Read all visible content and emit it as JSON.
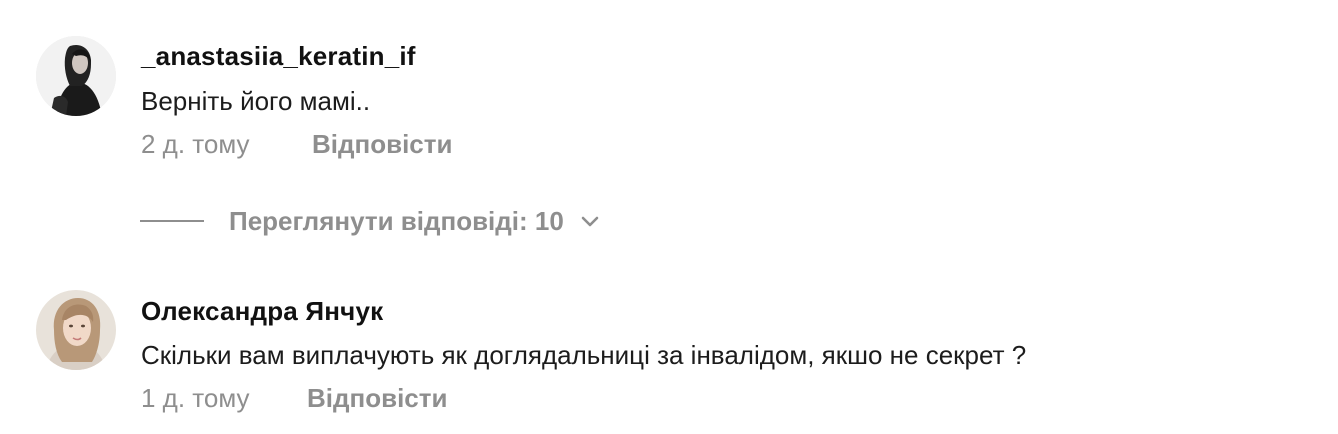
{
  "comments": [
    {
      "username": "_anastasiia_keratin_if",
      "text": "Верніть його мамі..",
      "time": "2 д. тому",
      "reply_label": "Відповісти",
      "avatar_icon": "user-avatar-dark"
    },
    {
      "username": "Олександра Янчук",
      "text": "Скільки вам виплачують як доглядальниці за інвалідом, якшо не секрет ?",
      "time": "1 д. тому",
      "reply_label": "Відповісти",
      "avatar_icon": "user-avatar-light"
    }
  ],
  "view_replies": {
    "label": "Переглянути відповіді: 10",
    "icon": "chevron-down-icon"
  },
  "colors": {
    "secondary_text": "#8e8e8e",
    "primary_text": "#111111",
    "background": "#ffffff"
  }
}
